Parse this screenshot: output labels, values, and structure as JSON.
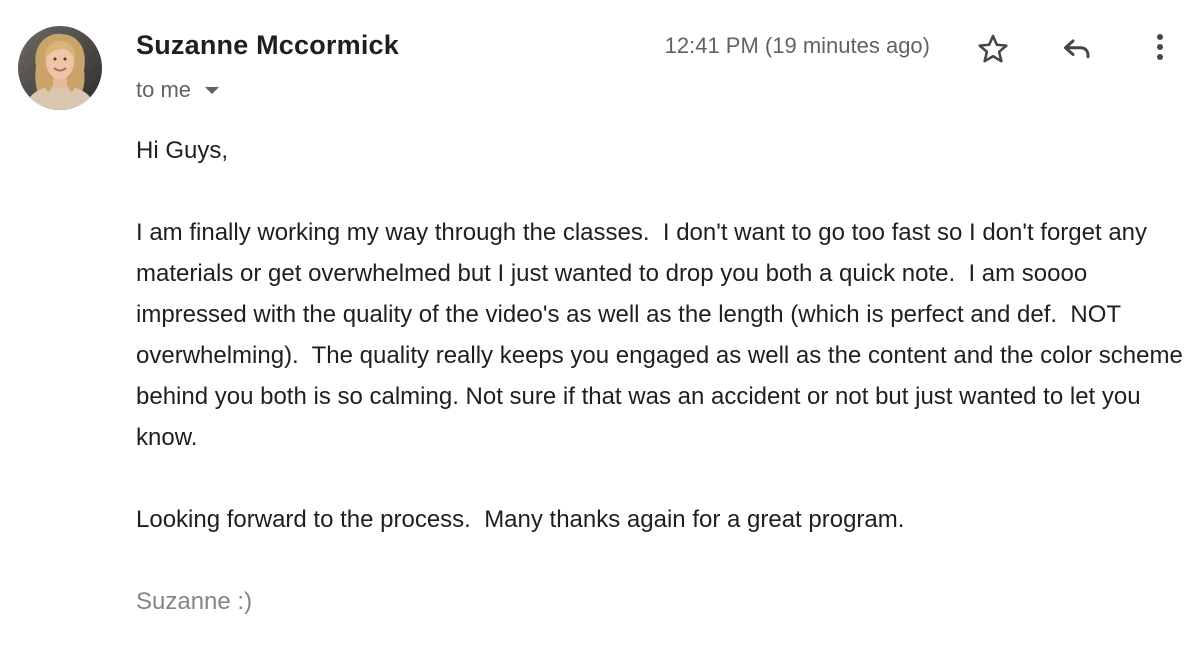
{
  "header": {
    "sender_name": "Suzanne Mccormick",
    "recipient_label": "to me",
    "timestamp": "12:41 PM (19 minutes ago)"
  },
  "icons": {
    "star": "star-icon",
    "reply": "reply-icon",
    "more": "more-vert-icon",
    "recipient_dropdown": "caret-down-icon"
  },
  "message": {
    "greeting": "Hi Guys,",
    "paragraph_1": "I am finally working my way through the classes.  I don't want to go too fast so I don't forget any materials or get overwhelmed but I just wanted to drop you both a quick note.  I am soooo impressed with the quality of the video's as well as the length (which is perfect and def.  NOT overwhelming).  The quality really keeps you engaged as well as the content and the color scheme behind you both is so calming. Not sure if that was an accident or not but just wanted to let you know.",
    "paragraph_2": "Looking forward to the process.  Many thanks again for a great program.",
    "signature": "Suzanne :)"
  },
  "colors": {
    "primary_text": "#1f1f1f",
    "secondary_text": "#5f6368",
    "signature_text": "#80868b",
    "icon": "#444746"
  }
}
